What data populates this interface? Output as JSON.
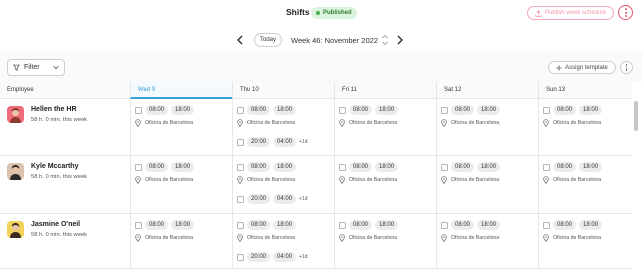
{
  "header": {
    "title": "Shifts",
    "status_badge": "Published",
    "publish_button": "Publish week schedule",
    "colors": {
      "accent": "#e6566e",
      "published_bg": "#dcf3dc",
      "published_text": "#2f7d32",
      "active_day": "#3aa0d8"
    }
  },
  "week_nav": {
    "today_label": "Today",
    "week_label": "Week 46: November 2022"
  },
  "toolbar": {
    "filter_label": "Filter",
    "assign_label": "Assign template"
  },
  "columns": {
    "employee": "Employee",
    "days": [
      "Wed 9",
      "Thu 10",
      "Fri 11",
      "Sat 12",
      "Sun 13"
    ]
  },
  "employees": [
    {
      "name": "Hellen the HR",
      "hours": "58 h. 0 min. this week",
      "shift_start": "08:00",
      "shift_end": "18:00",
      "location": "Oficina de Barcelona",
      "extra_start": "20:00",
      "extra_end": "04:00",
      "extra_note": "+1d"
    },
    {
      "name": "Kyle Mccarthy",
      "hours": "58 h. 0 min. this week",
      "shift_start": "08:00",
      "shift_end": "18:00",
      "location": "Oficina de Barcelona",
      "extra_start": "20:00",
      "extra_end": "04:00",
      "extra_note": "+1d"
    },
    {
      "name": "Jasmine O'neil",
      "hours": "58 h. 0 min. this week",
      "shift_start": "08:00",
      "shift_end": "18:00",
      "location": "Oficina de Barcelona",
      "extra_start": "20:00",
      "extra_end": "04:00",
      "extra_note": "+1d"
    }
  ],
  "icons": [
    "upload-icon",
    "kebab-menu-icon",
    "chevron-left-icon",
    "chevron-right-icon",
    "stepper-icon",
    "filter-icon",
    "chevron-down-icon",
    "plus-icon",
    "location-pin-icon"
  ]
}
